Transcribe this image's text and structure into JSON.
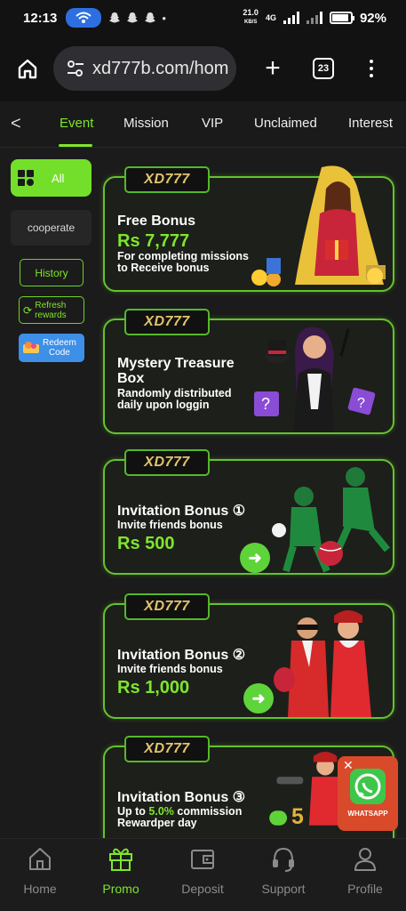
{
  "status_bar": {
    "time": "12:13",
    "net_speed": "21.0",
    "net_unit": "KB/S",
    "net_type": "4G",
    "battery": "92%",
    "battery_level": 0.92
  },
  "browser": {
    "url": "xd777b.com/hom",
    "tab_count": "23"
  },
  "tabs": [
    {
      "label": "Event",
      "active": true
    },
    {
      "label": "Mission",
      "active": false
    },
    {
      "label": "VIP",
      "active": false
    },
    {
      "label": "Unclaimed",
      "active": false
    },
    {
      "label": "Interest",
      "active": false
    }
  ],
  "sidebar": {
    "all_label": "All",
    "cooperate_label": "cooperate",
    "history_label": "History",
    "refresh_label": "Refresh\nrewards",
    "redeem_label": "Redeem\nCode"
  },
  "cards": [
    {
      "logo": "XD777",
      "title": "Free Bonus",
      "amount": "Rs 7,777",
      "desc": "For completing missions\nto Receive bonus"
    },
    {
      "logo": "XD777",
      "title": "Mystery Treasure\nBox",
      "desc": "Randomly distributed\ndaily upon loggin"
    },
    {
      "logo": "XD777",
      "title": "Invitation Bonus",
      "num": "①",
      "desc": "Invite friends bonus",
      "amount": "Rs 500"
    },
    {
      "logo": "XD777",
      "title": "Invitation Bonus",
      "num": "②",
      "desc": "Invite friends bonus",
      "amount": "Rs 1,000"
    },
    {
      "logo": "XD777",
      "title": "Invitation Bonus",
      "num": "③",
      "desc_pre": "Up to ",
      "desc_highlight": "5.0%",
      "desc_post": " commission\nRewardper day",
      "badge": "WHATSAPP"
    }
  ],
  "bottom_nav": [
    {
      "label": "Home",
      "icon": "home-icon",
      "active": false
    },
    {
      "label": "Promo",
      "icon": "gift-icon",
      "active": true
    },
    {
      "label": "Deposit",
      "icon": "wallet-icon",
      "active": false
    },
    {
      "label": "Support",
      "icon": "headset-icon",
      "active": false
    },
    {
      "label": "Profile",
      "icon": "user-icon",
      "active": false
    }
  ],
  "colors": {
    "accent": "#7fe52c",
    "background": "#1b1b1b",
    "card_border": "#63c42b",
    "redeem": "#3d8fe8"
  }
}
